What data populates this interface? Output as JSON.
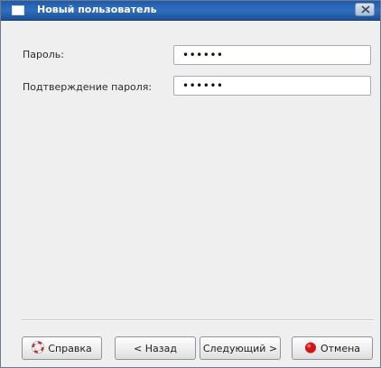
{
  "window": {
    "title": "Новый пользователь",
    "close_symbol": "X"
  },
  "form": {
    "password_label": "Пароль:",
    "password_value": "••••••",
    "confirm_label": "Подтверждение пароля:",
    "confirm_value": "••••••"
  },
  "buttons": {
    "help_label": "Справка",
    "help_icon": "lifebuoy-icon",
    "back_label": "< Назад",
    "next_label": "Следующий >",
    "cancel_label": "Отмена",
    "cancel_icon": "stop-icon"
  },
  "colors": {
    "titlebar": "#2f6fc0",
    "cancel_icon": "#d01818",
    "help_icon": "#e02020"
  }
}
